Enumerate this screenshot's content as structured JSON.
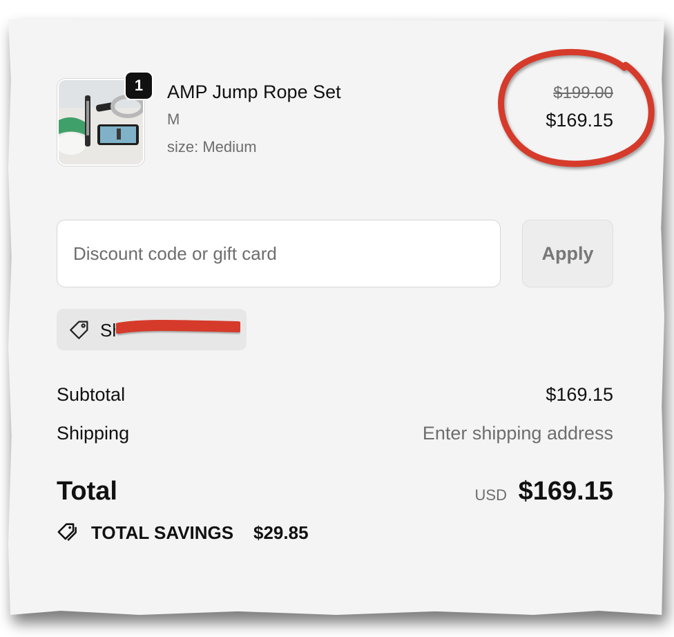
{
  "product": {
    "quantity": "1",
    "title": "AMP Jump Rope Set",
    "variant": "M",
    "option": "size: Medium",
    "original_price": "$199.00",
    "price": "$169.15",
    "image_icon": "product-photo"
  },
  "discount": {
    "placeholder": "Discount code or gift card",
    "value": "",
    "apply_label": "Apply",
    "applied_code_prefix": "Sh"
  },
  "summary": {
    "subtotal_label": "Subtotal",
    "subtotal_value": "$169.15",
    "shipping_label": "Shipping",
    "shipping_value": "Enter shipping address",
    "total_label": "Total",
    "currency": "USD",
    "total_value": "$169.15",
    "savings_label": "TOTAL SAVINGS",
    "savings_value": "$29.85"
  },
  "colors": {
    "annotation_red": "#d63a2a",
    "panel_bg": "#f4f4f4",
    "muted_text": "#6d6d6d"
  }
}
